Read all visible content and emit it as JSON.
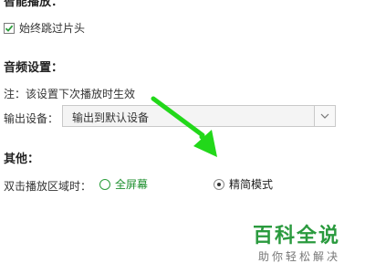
{
  "sections": {
    "smart_play_title": "智能播放：",
    "audio_title": "音频设置：",
    "other_title": "其他："
  },
  "skip_intro": {
    "label": "始终跳过片头",
    "checked": true
  },
  "audio": {
    "note": "注：该设置下次播放时生效",
    "output_label": "输出设备：",
    "output_value": "输出到默认设备"
  },
  "double_click": {
    "label": "双击播放区域时：",
    "options": [
      {
        "label": "全屏幕",
        "selected": false
      },
      {
        "label": "精简模式",
        "selected": true
      }
    ]
  },
  "watermark": {
    "title": "百科全说",
    "subtitle": "助你轻松解决"
  },
  "colors": {
    "accent_green": "#2a9d3a",
    "arrow_green": "#22d81a",
    "watermark_green": "#2a9a3e"
  },
  "icons": [
    "checkmark-icon",
    "chevron-down-icon",
    "radio-icon",
    "arrow-icon"
  ]
}
